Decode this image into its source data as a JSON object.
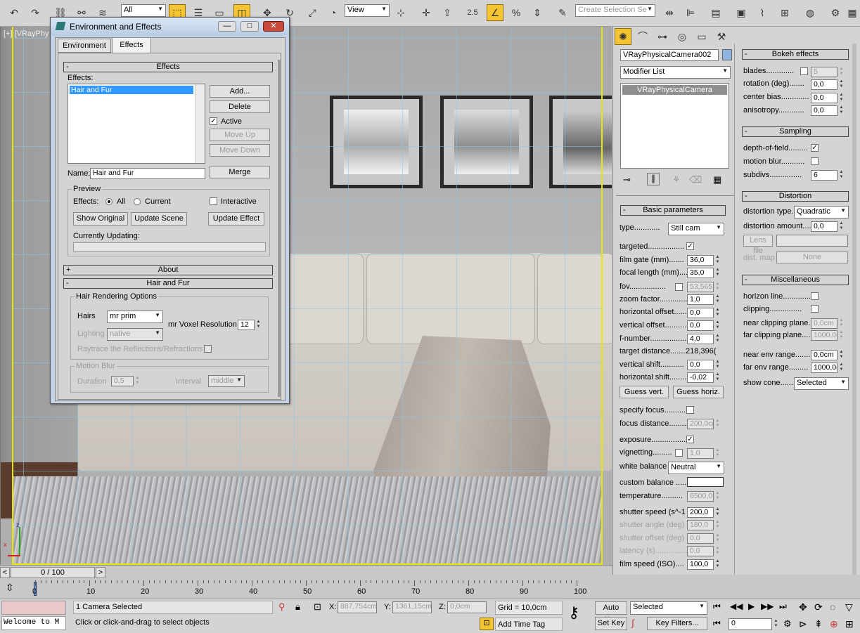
{
  "toolbar": {
    "selection_filter": "All",
    "ref_coord": "View",
    "named_selection_placeholder": "Create Selection Se",
    "spinner_snap_value": "2.5"
  },
  "viewport": {
    "label": "[+] [VRayPhy",
    "axis_z": "z",
    "axis_x": "x"
  },
  "dialog": {
    "title": "Environment and Effects",
    "min": "—",
    "max": "□",
    "close": "✕",
    "tabs": [
      "Environment",
      "Effects"
    ],
    "effects_rollout": "Effects",
    "effects_label": "Effects:",
    "effects_list": [
      "Hair and Fur"
    ],
    "add": "Add...",
    "delete": "Delete",
    "active": "Active",
    "move_up": "Move Up",
    "move_down": "Move Down",
    "name_label": "Name:",
    "name_value": "Hair and Fur",
    "merge": "Merge",
    "preview_label": "Preview",
    "effects_radio_label": "Effects:",
    "radio_all": "All",
    "radio_current": "Current",
    "interactive": "Interactive",
    "show_original": "Show Original",
    "update_scene": "Update Scene",
    "update_effect": "Update Effect",
    "currently_updating": "Currently Updating:",
    "about_rollout": "About",
    "about_sign": "+",
    "hair_rollout": "Hair and Fur",
    "minus": "-",
    "hair_rendering_options": "Hair Rendering Options",
    "hairs_label": "Hairs",
    "hairs_value": "mr prim",
    "lighting_label": "Lighting",
    "lighting_value": "native",
    "voxel_label": "mr Voxel Resolution",
    "voxel_value": "12",
    "raytrace_label": "Raytrace the Reflections/Refractions",
    "motion_blur": "Motion Blur",
    "duration_label": "Duration",
    "duration_value": "0,5",
    "interval_label": "Interval",
    "interval_value": "middle"
  },
  "command_panel": {
    "object_name": "VRayPhysicalCamera002",
    "modifier_list": "Modifier List",
    "stack_item": "VRayPhysicalCamera",
    "basic_rollout": "Basic parameters",
    "type_label": "type............",
    "type_value": "Still cam",
    "targeted": "targeted.................",
    "film_gate": "film gate (mm).......",
    "film_gate_v": "36,0",
    "focal_length": "focal length (mm)......",
    "focal_length_v": "35,0",
    "fov": "fov.................",
    "fov_v": "53,565",
    "zoom": "zoom factor.............",
    "zoom_v": "1,0",
    "h_offset": "horizontal offset.........",
    "h_offset_v": "0,0",
    "v_offset": "vertical offset..........",
    "v_offset_v": "0,0",
    "fnumber": "f-number...................",
    "fnumber_v": "4,0",
    "target_distance": "target distance.......",
    "target_distance_v": "218,396(",
    "v_shift": "vertical shift...........",
    "v_shift_v": "0,0",
    "h_shift": "horizontal shift........",
    "h_shift_v": "-0,02",
    "guess_vert": "Guess vert.",
    "guess_horiz": "Guess horiz.",
    "specify_focus": "specify focus..........",
    "focus_distance": "focus distance..........",
    "focus_distance_v": "200,0cm",
    "exposure": "exposure..................",
    "vignetting": "vignetting.........",
    "vignetting_v": "1,0",
    "white_balance": "white balance",
    "white_balance_v": "Neutral",
    "custom_balance": "custom balance .....",
    "temperature": "temperature..........",
    "temperature_v": "6500,0",
    "shutter_speed": "shutter speed (s^-1",
    "shutter_speed_v": "200,0",
    "shutter_angle": "shutter angle (deg)",
    "shutter_angle_v": "180,0",
    "shutter_offset": "shutter offset (deg)",
    "shutter_offset_v": "0,0",
    "latency": "latency (s)...............",
    "latency_v": "0,0",
    "film_speed": "film speed (ISO)....",
    "film_speed_v": "100,0"
  },
  "right_panel": {
    "bokeh": "Bokeh effects",
    "blades": "blades.............",
    "blades_v": "5",
    "rotation": "rotation (deg).......",
    "rotation_v": "0,0",
    "center_bias": "center bias.............",
    "center_bias_v": "0,0",
    "anisotropy": "anisotropy............",
    "anisotropy_v": "0,0",
    "sampling": "Sampling",
    "dof": "depth-of-field.........",
    "motion_blur": "motion blur...........",
    "subdivs": "subdivs...............",
    "subdivs_v": "6",
    "distortion": "Distortion",
    "dist_type": "distortion type.",
    "dist_type_v": "Quadratic",
    "dist_amount": "distortion amount....",
    "dist_amount_v": "0,0",
    "lens_file": "Lens file",
    "dist_map": "dist. map",
    "none": "None",
    "misc": "Miscellaneous",
    "horizon": "horizon line.............",
    "clipping": "clipping...............",
    "near_clip": "near clipping plane..",
    "near_clip_v": "0,0cm",
    "far_clip": "far clipping plane....",
    "far_clip_v": "1000,0c",
    "near_env": "near env range.......",
    "near_env_v": "0,0cm",
    "far_env": "far env range.........",
    "far_env_v": "1000,0c",
    "show_cone": "show cone..........",
    "show_cone_v": "Selected"
  },
  "timeline": {
    "frame": "0 / 100",
    "ticks": [
      "0",
      "10",
      "20",
      "30",
      "40",
      "50",
      "60",
      "70",
      "80",
      "90",
      "100"
    ]
  },
  "status": {
    "maxscript": "Welcome to M",
    "selected": "1 Camera Selected",
    "prompt": "Click or click-and-drag to select objects",
    "x_label": "X:",
    "x_value": "887,754cm",
    "y_label": "Y:",
    "y_value": "1361,15cm",
    "z_label": "Z:",
    "z_value": "0,0cm",
    "grid": "Grid = 10,0cm",
    "add_time_tag": "Add Time Tag",
    "auto_key": "Auto Key",
    "set_key": "Set Key",
    "key_mode": "Selected",
    "key_filters": "Key Filters...",
    "frame_value": "0"
  }
}
